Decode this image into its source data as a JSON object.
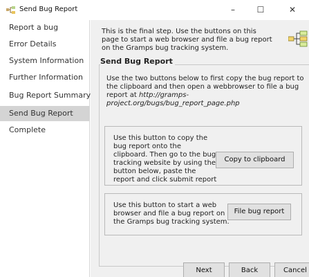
{
  "window": {
    "title": "Send Bug Report",
    "minimize_glyph": "–",
    "maximize_glyph": "☐",
    "close_glyph": "✕",
    "app_icon": "gramps-tree-icon"
  },
  "sidebar": {
    "items": [
      {
        "label": "Report a bug",
        "active": false
      },
      {
        "label": "Error Details",
        "active": false
      },
      {
        "label": "System Information",
        "active": false
      },
      {
        "label": "Further Information",
        "active": false
      },
      {
        "label": "Bug Report Summary",
        "active": false
      },
      {
        "label": "Send Bug Report",
        "active": true
      },
      {
        "label": "Complete",
        "active": false
      }
    ]
  },
  "main": {
    "intro": "This is the final step. Use the buttons on this page to start a web browser and file a bug report on the Gramps bug tracking system.",
    "header_icon": "network-icon",
    "group": {
      "title": "Send Bug Report",
      "description": "Use the two buttons below to first copy the bug report to the clipboard and then open a webbrowser to file a bug report at ",
      "url": "http://gramps-project.org/bugs/bug_report_page.php"
    },
    "copy_panel": {
      "text": "Use this button to copy the bug report onto the clipboard. Then go to the bug tracking website by using the button below, paste the report and click submit report",
      "button": "Copy to clipboard"
    },
    "file_panel": {
      "text": "Use this button to start a web browser and file a bug report on the Gramps bug tracking system.",
      "button": "File bug report"
    }
  },
  "footer": {
    "next": "Next",
    "back": "Back",
    "cancel": "Cancel"
  },
  "colors": {
    "sidebar_active": "#d4d4d4",
    "content_bg": "#f0f0f0",
    "button_bg": "#e1e1e1"
  }
}
